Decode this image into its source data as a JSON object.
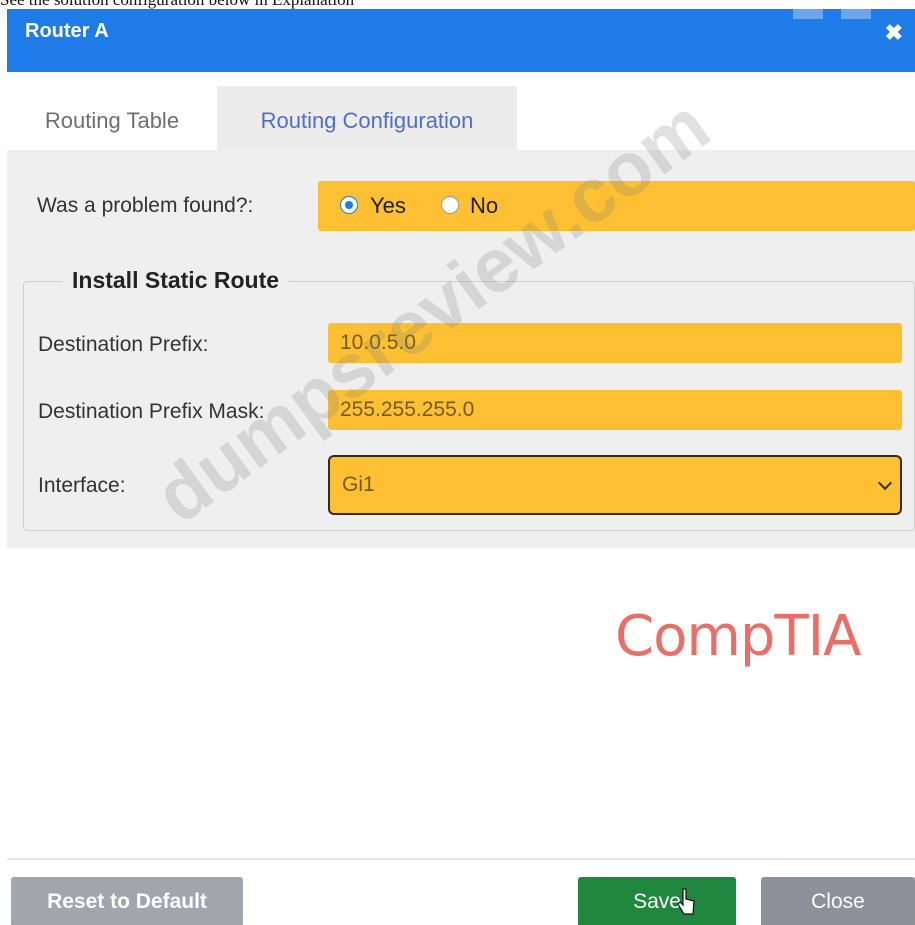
{
  "top_caption": "See the solution configuration below in Explanation",
  "dialog": {
    "title": "Router A",
    "close_glyph": "✖"
  },
  "tabs": [
    {
      "label": "Routing Table",
      "active": false
    },
    {
      "label": "Routing Configuration",
      "active": true
    }
  ],
  "form": {
    "problem_question": "Was a problem found?:",
    "problem_options": [
      {
        "label": "Yes",
        "selected": true
      },
      {
        "label": "No",
        "selected": false
      }
    ],
    "section_title": "Install Static Route",
    "destination_prefix_label": "Destination Prefix:",
    "destination_prefix_value": "10.0.5.0",
    "destination_mask_label": "Destination Prefix Mask:",
    "destination_mask_value": "255.255.255.0",
    "interface_label": "Interface:",
    "interface_value": "Gi1"
  },
  "watermark": "dumpsreview.com",
  "brand": "CompTIA",
  "buttons": {
    "reset": "Reset to Default",
    "save": "Save",
    "close": "Close"
  },
  "colors": {
    "title_bar": "#1f7be8",
    "highlight": "#fcc032",
    "save_button": "#20873f",
    "close_button": "#8c9299",
    "reset_button": "#a1a6ad",
    "brand": "#ea6e66"
  },
  "icons": {
    "close": "close-icon",
    "dropdown": "chevron-down-icon",
    "cursor": "hand-cursor-icon"
  }
}
